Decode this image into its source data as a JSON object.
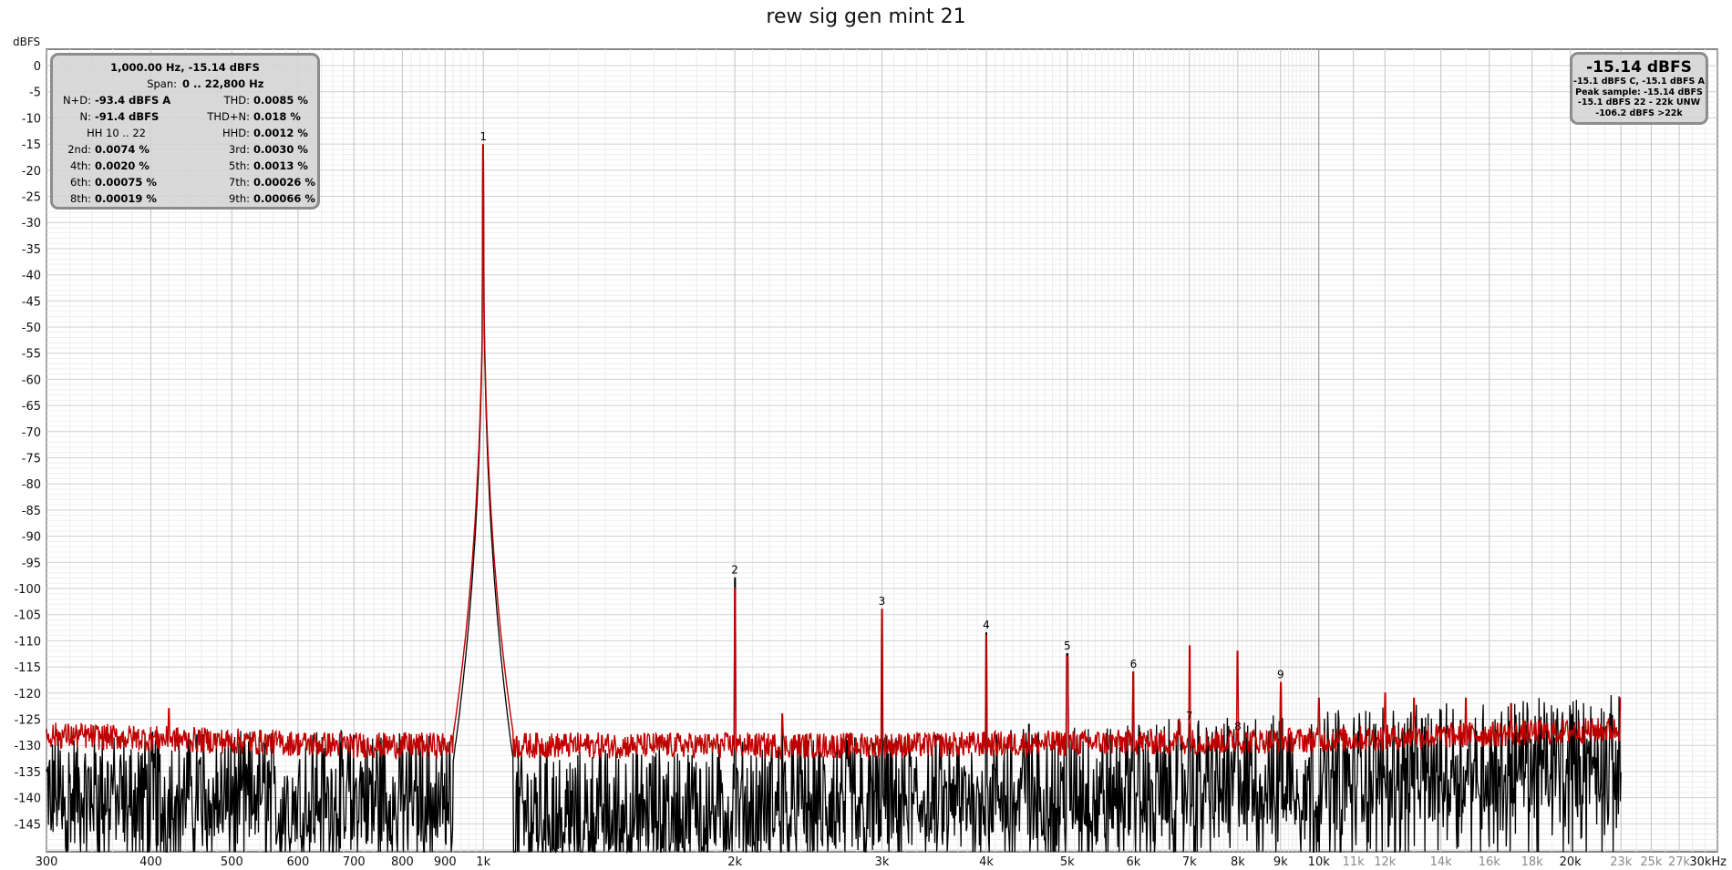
{
  "chart_data": {
    "type": "line",
    "title": "rew sig gen mint 21",
    "ylabel": "dBFS",
    "xscale": "log",
    "xlim": [
      300,
      30000
    ],
    "ylim": [
      -150,
      3
    ],
    "grid": true,
    "y_ticks": [
      0,
      -5,
      -10,
      -15,
      -20,
      -25,
      -30,
      -35,
      -40,
      -45,
      -50,
      -55,
      -60,
      -65,
      -70,
      -75,
      -80,
      -85,
      -90,
      -95,
      -100,
      -105,
      -110,
      -115,
      -120,
      -125,
      -130,
      -135,
      -140,
      -145
    ],
    "x_ticks": [
      {
        "label": "300",
        "value": 300,
        "major": true
      },
      {
        "label": "400",
        "value": 400,
        "major": true
      },
      {
        "label": "500",
        "value": 500,
        "major": true
      },
      {
        "label": "600",
        "value": 600,
        "major": true
      },
      {
        "label": "700",
        "value": 700,
        "major": true
      },
      {
        "label": "800",
        "value": 800,
        "major": true
      },
      {
        "label": "900",
        "value": 900,
        "major": true
      },
      {
        "label": "1k",
        "value": 1000,
        "major": true
      },
      {
        "label": "2k",
        "value": 2000,
        "major": true
      },
      {
        "label": "3k",
        "value": 3000,
        "major": true
      },
      {
        "label": "4k",
        "value": 4000,
        "major": true
      },
      {
        "label": "5k",
        "value": 5000,
        "major": true
      },
      {
        "label": "6k",
        "value": 6000,
        "major": true
      },
      {
        "label": "7k",
        "value": 7000,
        "major": true
      },
      {
        "label": "8k",
        "value": 8000,
        "major": true
      },
      {
        "label": "9k",
        "value": 9000,
        "major": true
      },
      {
        "label": "10k",
        "value": 10000,
        "major": true
      },
      {
        "label": "11k",
        "value": 11000,
        "major": false
      },
      {
        "label": "12k",
        "value": 12000,
        "major": false
      },
      {
        "label": "14k",
        "value": 14000,
        "major": false
      },
      {
        "label": "16k",
        "value": 16000,
        "major": false
      },
      {
        "label": "18k",
        "value": 18000,
        "major": false
      },
      {
        "label": "20k",
        "value": 20000,
        "major": true
      },
      {
        "label": "23k",
        "value": 23000,
        "major": false
      },
      {
        "label": "25k",
        "value": 25000,
        "major": false
      },
      {
        "label": "27k",
        "value": 27000,
        "major": false
      },
      {
        "label": "30kHz",
        "value": 30000,
        "major": true
      }
    ],
    "harmonics": [
      {
        "label": "1",
        "freq": 1000,
        "level": -15.14
      },
      {
        "label": "2",
        "freq": 2000,
        "level": -98
      },
      {
        "label": "3",
        "freq": 3000,
        "level": -104
      },
      {
        "label": "4",
        "freq": 4000,
        "level": -108.5
      },
      {
        "label": "5",
        "freq": 5000,
        "level": -112.5
      },
      {
        "label": "6",
        "freq": 6000,
        "level": -116
      },
      {
        "label": "7",
        "freq": 7000,
        "level": -126
      },
      {
        "label": "8",
        "freq": 8000,
        "level": -128
      },
      {
        "label": "9",
        "freq": 9000,
        "level": -118
      }
    ],
    "series": [
      {
        "color": "#c00000",
        "description": "averaged spectrum",
        "noise_floor": [
          [
            300,
            -128
          ],
          [
            700,
            -130
          ],
          [
            950,
            -130
          ],
          [
            1100,
            -130
          ],
          [
            3000,
            -130
          ],
          [
            10000,
            -129
          ],
          [
            23000,
            -127
          ]
        ],
        "peaks": [
          [
            1000,
            -15.14
          ],
          [
            2000,
            -100
          ],
          [
            3000,
            -104
          ],
          [
            4000,
            -109
          ],
          [
            5000,
            -113
          ],
          [
            6000,
            -116
          ],
          [
            7000,
            -111
          ],
          [
            8000,
            -112
          ],
          [
            9000,
            -118
          ],
          [
            10000,
            -121
          ],
          [
            12000,
            -120
          ],
          [
            13000,
            -121
          ],
          [
            15000,
            -121
          ],
          [
            17000,
            -122
          ],
          [
            420,
            -123
          ],
          [
            2280,
            -124
          ],
          [
            6800,
            -125
          ],
          [
            23000,
            -121
          ]
        ]
      },
      {
        "color": "#000000",
        "description": "instantaneous spectrum",
        "noise_floor": [
          [
            300,
            -138
          ],
          [
            900,
            -138
          ],
          [
            1100,
            -142
          ],
          [
            5000,
            -137
          ],
          [
            23000,
            -131
          ]
        ],
        "peaks": [
          [
            1000,
            -15.14
          ],
          [
            2000,
            -98
          ],
          [
            3000,
            -104
          ],
          [
            4000,
            -108.5
          ],
          [
            5000,
            -112.5
          ],
          [
            6000,
            -116
          ],
          [
            7000,
            -126
          ],
          [
            8000,
            -128
          ],
          [
            9000,
            -118
          ],
          [
            2280,
            -126
          ],
          [
            4500,
            -126
          ],
          [
            6800,
            -128
          ]
        ]
      }
    ],
    "freq_end": 23000
  },
  "measurement_box": {
    "header": "1,000.00 Hz, -15.14 dBFS",
    "span_label": "Span:",
    "span_value": "0 .. 22,800 Hz",
    "hh_range": "HH 10 .. 22",
    "rows": [
      {
        "l1": "N+D:",
        "v1": "-93.4 dBFS A",
        "l2": "THD:",
        "v2": "0.0085 %"
      },
      {
        "l1": "N:",
        "v1": "-91.4 dBFS",
        "l2": "THD+N:",
        "v2": "0.018 %"
      },
      {
        "l1": "2nd:",
        "v1": "0.0074 %",
        "l2": "3rd:",
        "v2": "0.0030 %"
      },
      {
        "l1": "4th:",
        "v1": "0.0020 %",
        "l2": "5th:",
        "v2": "0.0013 %"
      },
      {
        "l1": "6th:",
        "v1": "0.00075 %",
        "l2": "7th:",
        "v2": "0.00026 %"
      },
      {
        "l1": "8th:",
        "v1": "0.00019 %",
        "l2": "9th:",
        "v2": "0.00066 %"
      }
    ],
    "hhd_label": "HHD:",
    "hhd_value": "0.0012 %"
  },
  "level_box": {
    "main": "-15.14 dBFS",
    "line1": "-15.1 dBFS C, -15.1 dBFS A",
    "line2": "Peak sample: -15.14 dBFS",
    "line3": "-15.1 dBFS 22 - 22k UNW",
    "line4": "-106.2 dBFS >22k"
  }
}
